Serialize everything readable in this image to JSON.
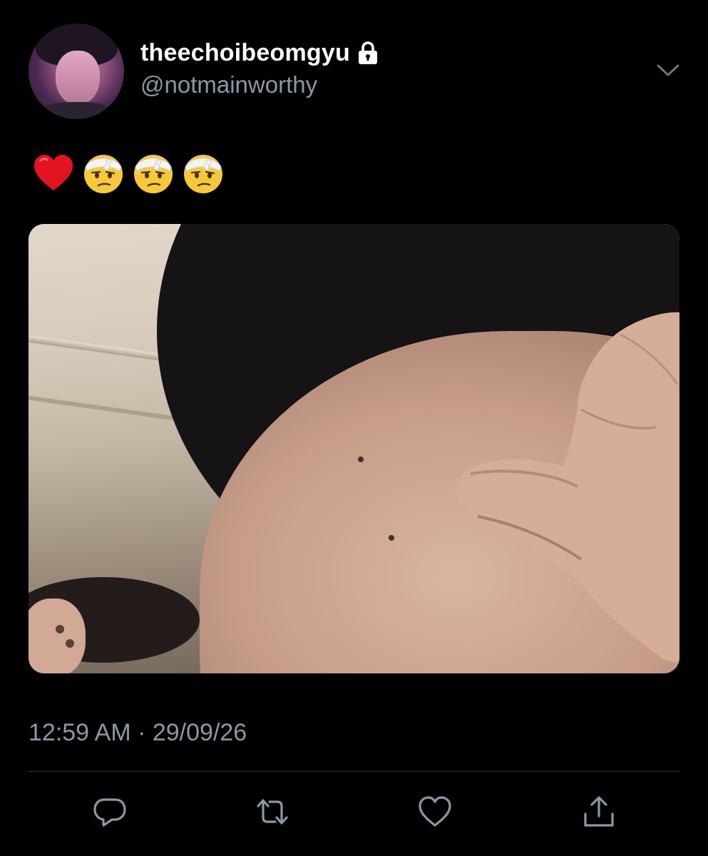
{
  "tweet": {
    "display_name": "theechoibeomgyu",
    "handle": "@notmainworthy",
    "protected_icon": "lock-icon",
    "menu_icon": "chevron-down-icon",
    "text_emojis": [
      "red-heart-emoji",
      "face-with-head-bandage-emoji",
      "face-with-head-bandage-emoji",
      "face-with-head-bandage-emoji"
    ],
    "timestamp": "12:59 AM · 29/09/26"
  },
  "actions": {
    "reply_icon": "reply-icon",
    "retweet_icon": "retweet-icon",
    "like_icon": "heart-icon",
    "share_icon": "share-icon"
  },
  "colors": {
    "background": "#000000",
    "primary_text": "#ffffff",
    "secondary_text": "#8b98a5",
    "divider": "#2f3336"
  }
}
